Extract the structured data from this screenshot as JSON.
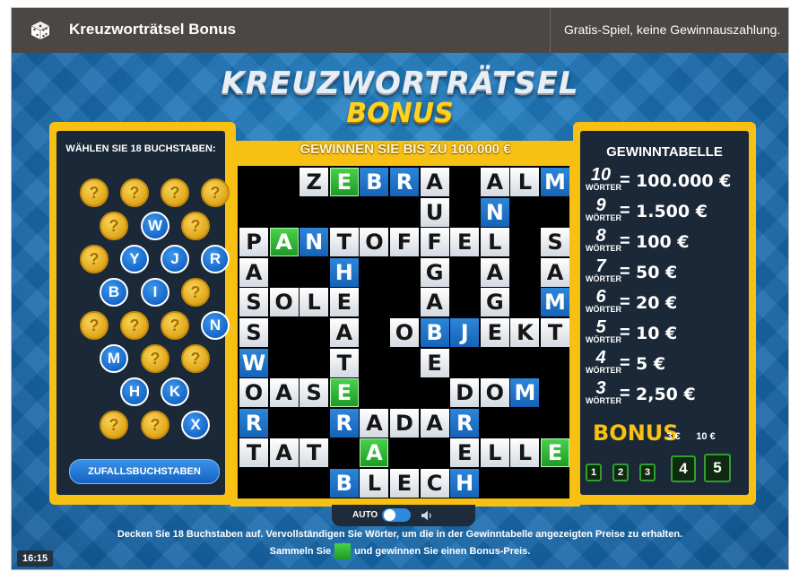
{
  "header": {
    "title": "Kreuzworträtsel Bonus",
    "note": "Gratis-Spiel, keine Gewinnauszahlung."
  },
  "logo": {
    "line1": "KREUZWORTRÄTSEL",
    "line2": "BONUS"
  },
  "left_panel": {
    "title": "WÄHLEN SIE 18 BUCHSTABEN:",
    "coins": [
      {
        "label": "?",
        "state": "hidden"
      },
      {
        "label": "?",
        "state": "hidden"
      },
      {
        "label": "?",
        "state": "hidden"
      },
      {
        "label": "?",
        "state": "hidden"
      },
      {
        "label": "?",
        "state": "hidden"
      },
      {
        "label": "W",
        "state": "revealed"
      },
      {
        "label": "?",
        "state": "hidden"
      },
      {
        "label": "?",
        "state": "hidden"
      },
      {
        "label": "Y",
        "state": "revealed"
      },
      {
        "label": "J",
        "state": "revealed"
      },
      {
        "label": "R",
        "state": "revealed"
      },
      {
        "label": "B",
        "state": "revealed"
      },
      {
        "label": "I",
        "state": "revealed"
      },
      {
        "label": "?",
        "state": "hidden"
      },
      {
        "label": "?",
        "state": "hidden"
      },
      {
        "label": "?",
        "state": "hidden"
      },
      {
        "label": "?",
        "state": "hidden"
      },
      {
        "label": "N",
        "state": "revealed"
      },
      {
        "label": "M",
        "state": "revealed"
      },
      {
        "label": "?",
        "state": "hidden"
      },
      {
        "label": "?",
        "state": "hidden"
      },
      {
        "label": "H",
        "state": "revealed"
      },
      {
        "label": "K",
        "state": "revealed"
      },
      {
        "label": "?",
        "state": "hidden"
      },
      {
        "label": "?",
        "state": "hidden"
      },
      {
        "label": "X",
        "state": "revealed"
      }
    ],
    "random_button": "ZUFALLSBUCHSTABEN"
  },
  "board": {
    "title": "GEWINNEN SIE BIS ZU 100.000 €",
    "cells": [
      {
        "r": 0,
        "c": 2,
        "ch": "Z",
        "s": "w"
      },
      {
        "r": 0,
        "c": 3,
        "ch": "E",
        "s": "g"
      },
      {
        "r": 0,
        "c": 4,
        "ch": "B",
        "s": "b"
      },
      {
        "r": 0,
        "c": 5,
        "ch": "R",
        "s": "b"
      },
      {
        "r": 0,
        "c": 6,
        "ch": "A",
        "s": "w"
      },
      {
        "r": 0,
        "c": 8,
        "ch": "A",
        "s": "w"
      },
      {
        "r": 0,
        "c": 9,
        "ch": "L",
        "s": "w"
      },
      {
        "r": 0,
        "c": 10,
        "ch": "M",
        "s": "b"
      },
      {
        "r": 1,
        "c": 6,
        "ch": "U",
        "s": "w"
      },
      {
        "r": 1,
        "c": 8,
        "ch": "N",
        "s": "b"
      },
      {
        "r": 2,
        "c": 0,
        "ch": "P",
        "s": "w"
      },
      {
        "r": 2,
        "c": 1,
        "ch": "A",
        "s": "g"
      },
      {
        "r": 2,
        "c": 2,
        "ch": "N",
        "s": "b"
      },
      {
        "r": 2,
        "c": 3,
        "ch": "T",
        "s": "w"
      },
      {
        "r": 2,
        "c": 4,
        "ch": "O",
        "s": "w"
      },
      {
        "r": 2,
        "c": 5,
        "ch": "F",
        "s": "w"
      },
      {
        "r": 2,
        "c": 6,
        "ch": "F",
        "s": "w"
      },
      {
        "r": 2,
        "c": 7,
        "ch": "E",
        "s": "w"
      },
      {
        "r": 2,
        "c": 8,
        "ch": "L",
        "s": "w"
      },
      {
        "r": 2,
        "c": 10,
        "ch": "S",
        "s": "w"
      },
      {
        "r": 3,
        "c": 0,
        "ch": "A",
        "s": "w"
      },
      {
        "r": 3,
        "c": 3,
        "ch": "H",
        "s": "b"
      },
      {
        "r": 3,
        "c": 6,
        "ch": "G",
        "s": "w"
      },
      {
        "r": 3,
        "c": 8,
        "ch": "A",
        "s": "w"
      },
      {
        "r": 3,
        "c": 10,
        "ch": "A",
        "s": "w"
      },
      {
        "r": 4,
        "c": 0,
        "ch": "S",
        "s": "w"
      },
      {
        "r": 4,
        "c": 1,
        "ch": "O",
        "s": "w"
      },
      {
        "r": 4,
        "c": 2,
        "ch": "L",
        "s": "w"
      },
      {
        "r": 4,
        "c": 3,
        "ch": "E",
        "s": "w"
      },
      {
        "r": 4,
        "c": 6,
        "ch": "A",
        "s": "w"
      },
      {
        "r": 4,
        "c": 8,
        "ch": "G",
        "s": "w"
      },
      {
        "r": 4,
        "c": 10,
        "ch": "M",
        "s": "b"
      },
      {
        "r": 5,
        "c": 0,
        "ch": "S",
        "s": "w"
      },
      {
        "r": 5,
        "c": 3,
        "ch": "A",
        "s": "w"
      },
      {
        "r": 5,
        "c": 5,
        "ch": "O",
        "s": "w"
      },
      {
        "r": 5,
        "c": 6,
        "ch": "B",
        "s": "b"
      },
      {
        "r": 5,
        "c": 7,
        "ch": "J",
        "s": "b"
      },
      {
        "r": 5,
        "c": 8,
        "ch": "E",
        "s": "w"
      },
      {
        "r": 5,
        "c": 9,
        "ch": "K",
        "s": "w"
      },
      {
        "r": 5,
        "c": 10,
        "ch": "T",
        "s": "w"
      },
      {
        "r": 6,
        "c": 0,
        "ch": "W",
        "s": "b"
      },
      {
        "r": 6,
        "c": 3,
        "ch": "T",
        "s": "w"
      },
      {
        "r": 6,
        "c": 6,
        "ch": "E",
        "s": "w"
      },
      {
        "r": 7,
        "c": 0,
        "ch": "O",
        "s": "w"
      },
      {
        "r": 7,
        "c": 1,
        "ch": "A",
        "s": "w"
      },
      {
        "r": 7,
        "c": 2,
        "ch": "S",
        "s": "w"
      },
      {
        "r": 7,
        "c": 3,
        "ch": "E",
        "s": "g"
      },
      {
        "r": 7,
        "c": 7,
        "ch": "D",
        "s": "w"
      },
      {
        "r": 7,
        "c": 8,
        "ch": "O",
        "s": "w"
      },
      {
        "r": 7,
        "c": 9,
        "ch": "M",
        "s": "b"
      },
      {
        "r": 8,
        "c": 0,
        "ch": "R",
        "s": "b"
      },
      {
        "r": 8,
        "c": 3,
        "ch": "R",
        "s": "b"
      },
      {
        "r": 8,
        "c": 4,
        "ch": "A",
        "s": "w"
      },
      {
        "r": 8,
        "c": 5,
        "ch": "D",
        "s": "w"
      },
      {
        "r": 8,
        "c": 6,
        "ch": "A",
        "s": "w"
      },
      {
        "r": 8,
        "c": 7,
        "ch": "R",
        "s": "b"
      },
      {
        "r": 9,
        "c": 0,
        "ch": "T",
        "s": "w"
      },
      {
        "r": 9,
        "c": 1,
        "ch": "A",
        "s": "w"
      },
      {
        "r": 9,
        "c": 2,
        "ch": "T",
        "s": "w"
      },
      {
        "r": 9,
        "c": 4,
        "ch": "A",
        "s": "g"
      },
      {
        "r": 9,
        "c": 7,
        "ch": "E",
        "s": "w"
      },
      {
        "r": 9,
        "c": 8,
        "ch": "L",
        "s": "w"
      },
      {
        "r": 9,
        "c": 9,
        "ch": "L",
        "s": "w"
      },
      {
        "r": 9,
        "c": 10,
        "ch": "E",
        "s": "g"
      },
      {
        "r": 10,
        "c": 3,
        "ch": "B",
        "s": "b"
      },
      {
        "r": 10,
        "c": 4,
        "ch": "L",
        "s": "w"
      },
      {
        "r": 10,
        "c": 5,
        "ch": "E",
        "s": "w"
      },
      {
        "r": 10,
        "c": 6,
        "ch": "C",
        "s": "w"
      },
      {
        "r": 10,
        "c": 7,
        "ch": "H",
        "s": "b"
      }
    ]
  },
  "prize_table": {
    "title": "GEWINNTABELLE",
    "word_label": "WÖRTER",
    "rows": [
      {
        "words": "10",
        "prize": "100.000 €"
      },
      {
        "words": "9",
        "prize": "1.500 €"
      },
      {
        "words": "8",
        "prize": "100 €"
      },
      {
        "words": "7",
        "prize": "50 €"
      },
      {
        "words": "6",
        "prize": "20 €"
      },
      {
        "words": "5",
        "prize": "10 €"
      },
      {
        "words": "4",
        "prize": "5 €"
      },
      {
        "words": "3",
        "prize": "2,50 €"
      }
    ],
    "bonus_label": "BONUS",
    "bonus_prizes": [
      "3 €",
      "10 €"
    ],
    "bonus_slots": [
      "1",
      "2",
      "3",
      "4",
      "5"
    ]
  },
  "controls": {
    "auto_label": "AUTO",
    "auto_on": true
  },
  "instructions": {
    "line1": "Decken Sie 18 Buchstaben auf. Vervollständigen Sie Wörter, um die in der Gewinntabelle angezeigten Preise zu erhalten.",
    "line2a": "Sammeln Sie",
    "line2b": "und gewinnen Sie einen Bonus-Preis."
  },
  "clock": "16:15",
  "colors": {
    "gold": "#f7c012",
    "panel": "#1a2838",
    "letter_blue": "#1563b8",
    "bonus_green": "#1f9a26"
  }
}
